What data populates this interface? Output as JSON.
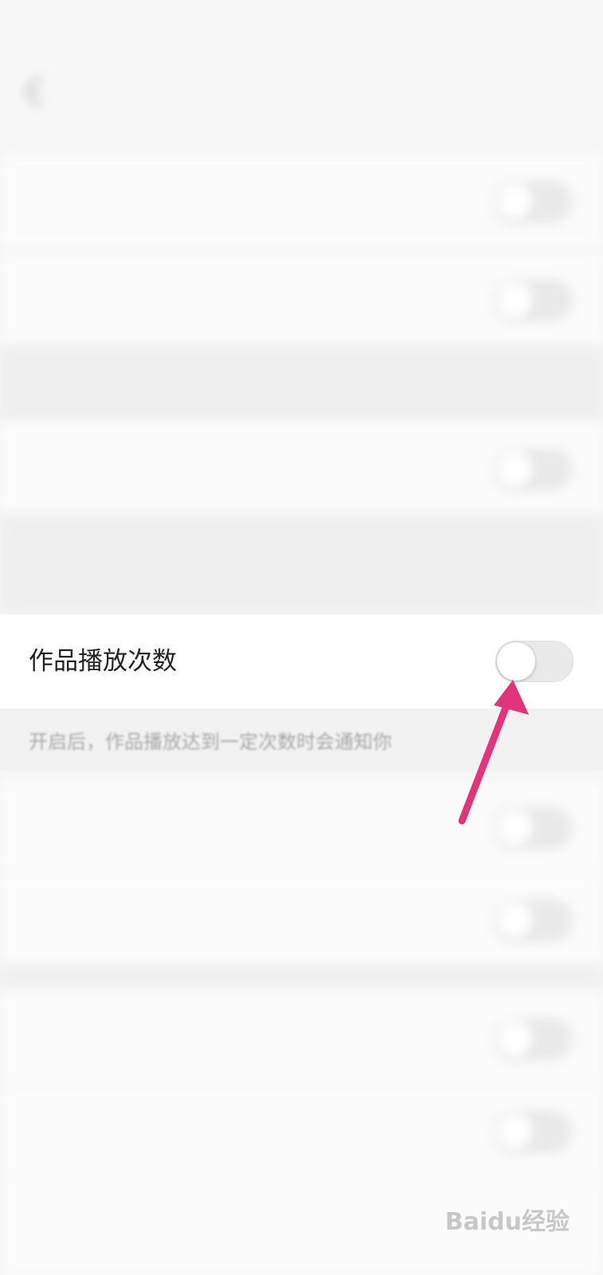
{
  "status_bar": {
    "left": "",
    "right": ""
  },
  "header": {
    "title": "",
    "back_icon": "chevron-left-icon"
  },
  "rows_above": [
    {
      "label": "",
      "enabled": false
    },
    {
      "label": "",
      "enabled": false
    },
    {
      "label": "",
      "enabled": false
    }
  ],
  "notes_above": [
    {
      "text": ""
    },
    {
      "text": ""
    }
  ],
  "focused_setting": {
    "label": "作品播放次数",
    "enabled": false,
    "note": "开启后，作品播放达到一定次数时会通知你"
  },
  "rows_below": [
    {
      "label": "",
      "enabled": false
    },
    {
      "label": "",
      "enabled": false
    },
    {
      "label": "",
      "enabled": false
    },
    {
      "label": "",
      "enabled": false
    },
    {
      "label": "",
      "enabled": false
    }
  ],
  "annotation": {
    "arrow_color": "#e0357a"
  },
  "watermark": {
    "text": "Baidu经验"
  }
}
